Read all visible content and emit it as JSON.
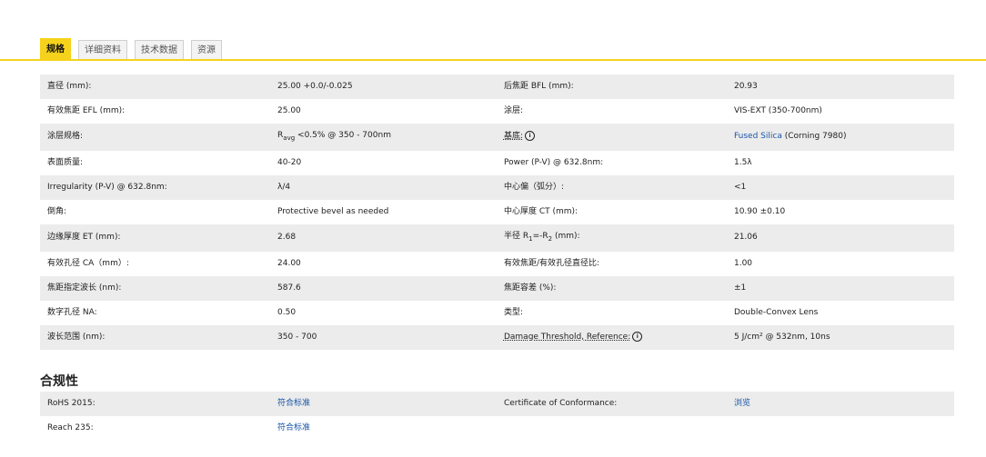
{
  "tabs": [
    {
      "label": "规格",
      "active": true
    },
    {
      "label": "详细资料",
      "active": false
    },
    {
      "label": "技术数据",
      "active": false
    },
    {
      "label": "资源",
      "active": false
    }
  ],
  "specs": [
    {
      "l1": "直径 (mm):",
      "v1": "25.00 +0.0/-0.025",
      "l2": "后焦距 BFL (mm):",
      "v2": "20.93"
    },
    {
      "l1": "有效焦距 EFL (mm):",
      "v1": "25.00",
      "l2": "涂层:",
      "v2": "VIS-EXT (350-700nm)"
    },
    {
      "l1": "涂层规格:",
      "v1a": "R",
      "v1sub": "avg",
      "v1b": " <0.5% @ 350 - 700nm",
      "l2": "基底:",
      "v2link": "Fused Silica",
      "v2rest": " (Corning 7980)"
    },
    {
      "l1": "表面质量:",
      "v1": "40-20",
      "l2": "Power (P-V) @ 632.8nm:",
      "v2": "1.5λ"
    },
    {
      "l1": "Irregularity (P-V) @ 632.8nm:",
      "v1": "λ/4",
      "l2": "中心偏（弧分）:",
      "v2": "<1"
    },
    {
      "l1": "倒角:",
      "v1": "Protective bevel as needed",
      "l2": "中心厚度 CT (mm):",
      "v2": "10.90 ±0.10"
    },
    {
      "l1": "边缘厚度 ET (mm):",
      "v1": "2.68",
      "l2a": "半径 R",
      "l2s1": "1",
      "l2b": "=-R",
      "l2s2": "2",
      "l2c": " (mm):",
      "v2": "21.06"
    },
    {
      "l1": "有效孔径 CA（mm）:",
      "v1": "24.00",
      "l2": "有效焦距/有效孔径直径比:",
      "v2": "1.00"
    },
    {
      "l1": "焦距指定波长 (nm):",
      "v1": "587.6",
      "l2": "焦距容差 (%):",
      "v2": "±1"
    },
    {
      "l1": "数字孔径 NA:",
      "v1": "0.50",
      "l2": "类型:",
      "v2": "Double-Convex Lens"
    },
    {
      "l1": "波长范围 (nm):",
      "v1": "350 - 700",
      "l2": "Damage Threshold, Reference:",
      "v2": "5 J/cm² @ 532nm, 10ns"
    }
  ],
  "info_glyph": "i",
  "compliance_title": "合规性",
  "compliance": [
    {
      "l1": "RoHS 2015:",
      "v1": "符合标准",
      "l2": "Certificate of Conformance:",
      "v2": "浏览"
    },
    {
      "l1": "Reach 235:",
      "v1": "符合标准",
      "l2": "",
      "v2": ""
    }
  ],
  "colors": {
    "accent": "#f6d21b",
    "link": "#1a56a8",
    "row_alt": "#ececec"
  }
}
